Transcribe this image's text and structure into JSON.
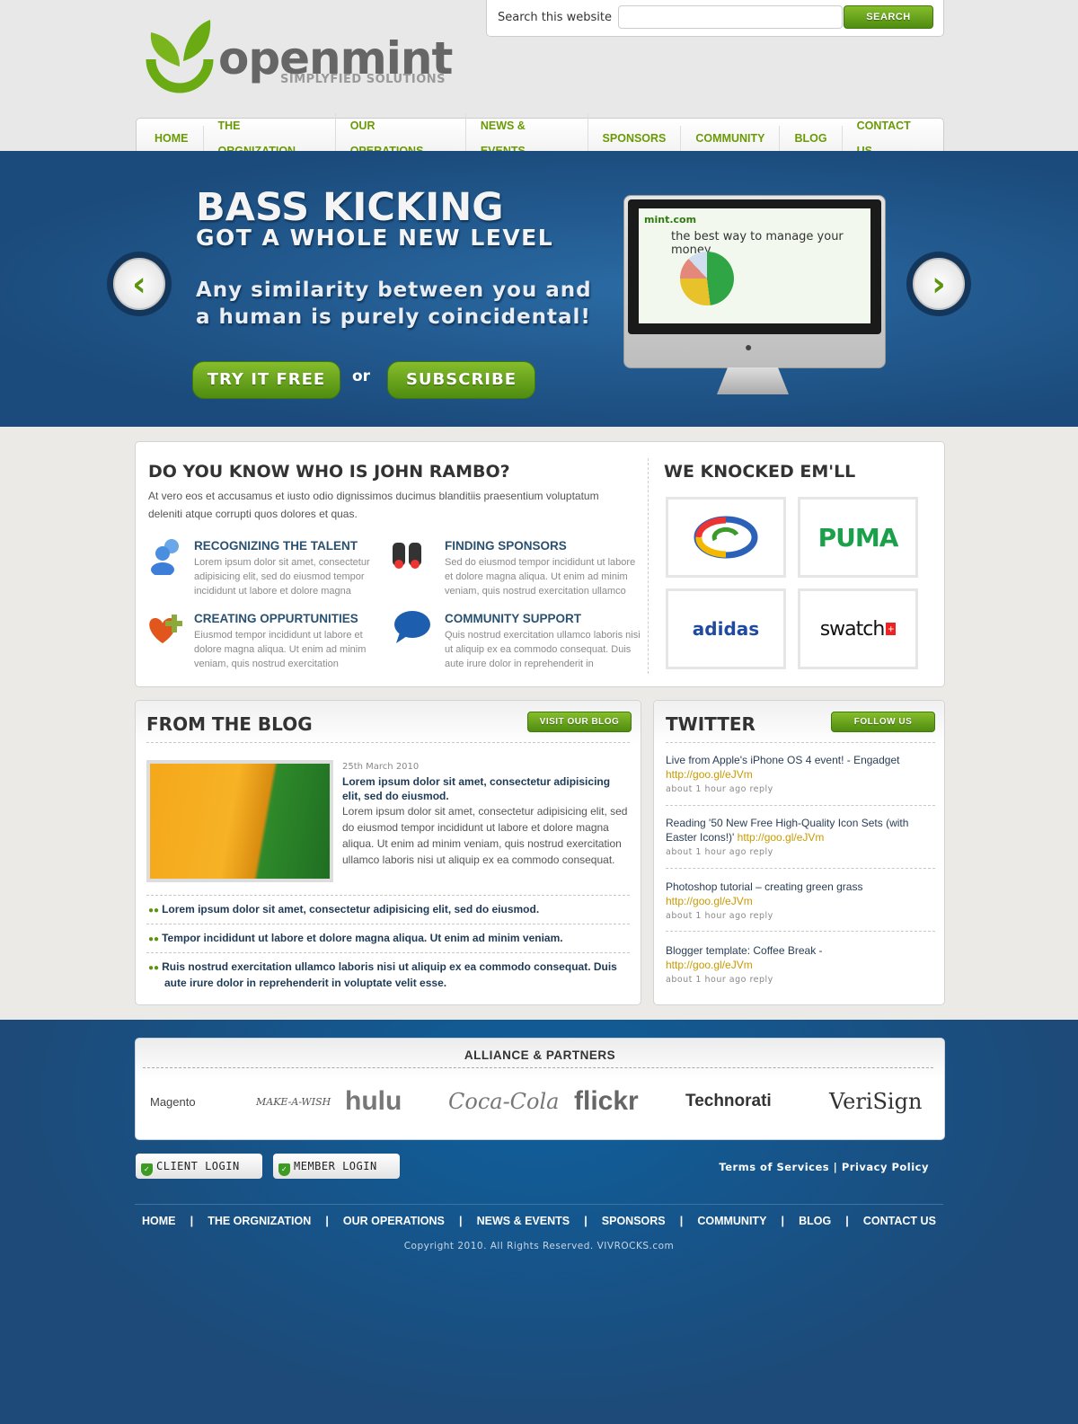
{
  "header": {
    "logo_word": "openmint",
    "logo_tagline": "SIMPLYFIED SOLUTIONS",
    "search_label": "Search this website",
    "search_value": "",
    "search_button": "SEARCH"
  },
  "nav": [
    "HOME",
    "THE ORGNIZATION",
    "OUR OPERATIONS",
    "NEWS & EVENTS",
    "SPONSORS",
    "COMMUNITY",
    "BLOG",
    "CONTACT US"
  ],
  "banner": {
    "title": "BASS KICKING",
    "subtitle": "GOT A WHOLE NEW LEVEL",
    "tagline": "Any similarity between you and a human is purely coincidental!",
    "try_button": "TRY IT FREE",
    "or": "or",
    "subscribe_button": "SUBSCRIBE",
    "screen_logo": "mint.com",
    "screen_tagline": "the best way to manage your money"
  },
  "about": {
    "title": "DO YOU KNOW WHO IS JOHN RAMBO?",
    "intro": "At vero eos et accusamus et iusto odio dignissimos ducimus blanditiis praesentium voluptatum deleniti atque corrupti quos dolores et quas.",
    "features": [
      {
        "icon": "users-icon",
        "title": "RECOGNIZING THE TALENT",
        "text": "Lorem ipsum dolor sit amet, consectetur adipisicing elit, sed do eiusmod tempor incididunt ut labore et dolore magna"
      },
      {
        "icon": "binoculars-icon",
        "title": "FINDING SPONSORS",
        "text": "Sed do eiusmod tempor incididunt ut labore et dolore magna aliqua. Ut enim ad minim veniam, quis nostrud exercitation ullamco"
      },
      {
        "icon": "heart-plus-icon",
        "title": "CREATING OPPURTUNITIES",
        "text": "Eiusmod tempor incididunt ut labore et dolore magna aliqua. Ut enim ad minim veniam, quis nostrud exercitation"
      },
      {
        "icon": "speech-bubble-icon",
        "title": "COMMUNITY SUPPORT",
        "text": "Quis nostrud exercitation ullamco laboris nisi ut aliquip ex ea commodo consequat. Duis aute irure dolor in reprehenderit in"
      }
    ]
  },
  "knocked": {
    "title": "WE KNOCKED EM'LL",
    "logos": [
      "PUMA",
      "adidas",
      "swatch"
    ]
  },
  "blog": {
    "title": "FROM THE BLOG",
    "button": "VISIT OUR BLOG",
    "date": "25th March 2010",
    "post_title": "Lorem ipsum dolor sit amet, consectetur adipisicing elit, sed do eiusmod.",
    "post_text": "Lorem ipsum dolor sit amet, consectetur adipisicing elit, sed do eiusmod tempor incididunt ut labore et dolore magna aliqua. Ut enim ad minim veniam, quis nostrud exercitation ullamco laboris nisi ut aliquip ex ea commodo consequat.",
    "links": [
      "Lorem ipsum dolor sit amet, consectetur adipisicing elit, sed do eiusmod.",
      "Tempor incididunt ut labore et dolore magna aliqua. Ut enim ad minim veniam.",
      "Ruis nostrud exercitation ullamco laboris nisi ut aliquip ex ea commodo consequat. Duis aute irure dolor in reprehenderit in voluptate velit esse."
    ]
  },
  "twitter": {
    "title": "TWITTER",
    "button": "FOLLOW US",
    "tweets": [
      {
        "text": "Live from Apple's iPhone OS 4 event! - Engadget",
        "link": "http://goo.gl/eJVm",
        "meta": "about 1 hour ago reply"
      },
      {
        "text": "Reading '50 New Free High-Quality Icon Sets (with Easter Icons!)'",
        "link": "http://goo.gl/eJVm",
        "meta": "about 1 hour ago reply"
      },
      {
        "text": "Photoshop tutorial – creating green grass",
        "link": "http://goo.gl/eJVm",
        "meta": "about 1 hour ago reply"
      },
      {
        "text": "Blogger template: Coffee Break -",
        "link": "http://goo.gl/eJVm",
        "meta": "about 1 hour ago reply"
      }
    ]
  },
  "footer": {
    "partners_title": "ALLIANCE & PARTNERS",
    "partners": [
      "Magento",
      "MAKE-A-WISH",
      "hulu",
      "Coca-Cola",
      "flickr",
      "Technorati",
      "VeriSign"
    ],
    "client_login": "CLIENT LOGIN",
    "member_login": "MEMBER LOGIN",
    "terms": "Terms of Services",
    "sep": "|",
    "privacy": "Privacy Policy",
    "nav": [
      "HOME",
      "THE ORGNIZATION",
      "OUR OPERATIONS",
      "NEWS & EVENTS",
      "SPONSORS",
      "COMMUNITY",
      "BLOG",
      "CONTACT US"
    ],
    "copyright": "Copyright 2010. All Rights Reserved. VIVROCKS.com"
  },
  "colors": {
    "accent_green": "#6a9a06",
    "brand_blue": "#1d4a78",
    "link_gold": "#c99a00"
  }
}
